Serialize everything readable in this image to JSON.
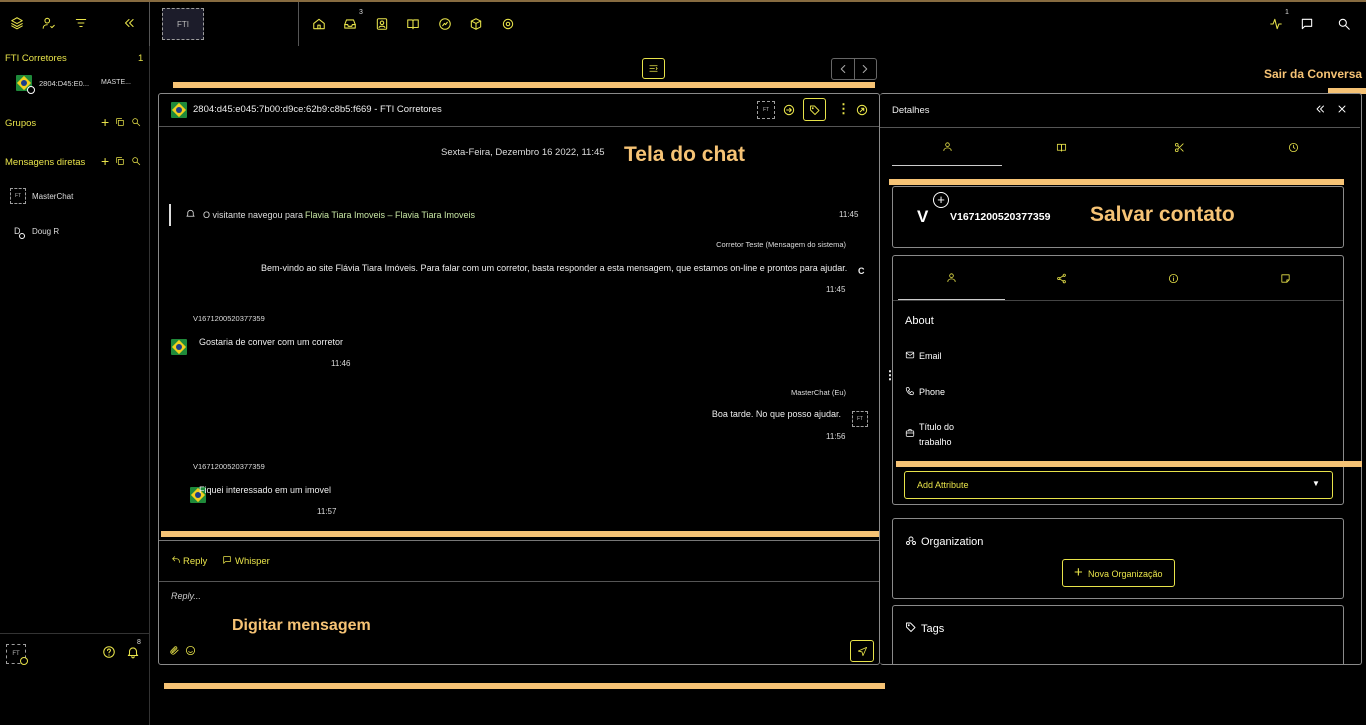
{
  "topbar": {
    "badge_inbox": "3",
    "badge_activity": "1"
  },
  "sidebar": {
    "section_main": "FTI Corretores",
    "section_main_count": "1",
    "conversation": {
      "id": "2804:D45:E0...",
      "owner": "MASTE..."
    },
    "section_groups": "Grupos",
    "section_direct": "Mensagens diretas",
    "direct_items": [
      {
        "name": "MasterChat"
      },
      {
        "name": "Doug R"
      }
    ],
    "bell_badge": "8"
  },
  "annotations": {
    "exit": "Sair da Conversa",
    "chat_screen": "Tela do chat",
    "save_contact": "Salvar contato",
    "type_message": "Digitar mensagem"
  },
  "chat": {
    "title": "2804:d45:e045:7b00:d9ce:62b9:c8b5:f669 - FTI Corretores",
    "date_header": "Sexta-Feira, Dezembro 16 2022, 11:45",
    "navigation": {
      "prefix": "O visitante navegou para",
      "link": "Flavia Tiara Imoveis – Flavia Tiara Imoveis",
      "time": "11:45"
    },
    "messages": [
      {
        "sender": "Corretor Teste (Mensagem do sistema)",
        "text": "Bem-vindo ao site Flávia Tiara Imóveis. Para falar com um corretor, basta responder a esta mensagem, que estamos on-line e prontos para ajudar.",
        "time": "11:45",
        "side": "right",
        "avatar": "C"
      },
      {
        "sender": "V1671200520377359",
        "text": "Gostaria de conver com um corretor",
        "time": "11:46",
        "side": "left"
      },
      {
        "sender": "MasterChat (Eu)",
        "text": "Boa tarde. No que posso ajudar.",
        "time": "11:56",
        "side": "right"
      },
      {
        "sender": "V1671200520377359",
        "text": "Fiquei interessado em um imovel",
        "time": "11:57",
        "side": "left"
      }
    ],
    "reply_tab": "Reply",
    "whisper_tab": "Whisper",
    "composer_placeholder": "Reply..."
  },
  "details": {
    "title": "Detalhes",
    "contact_initial": "V",
    "contact_name": "V1671200520377359",
    "about_title": "About",
    "fields": [
      {
        "label": "Email"
      },
      {
        "label": "Phone"
      },
      {
        "label": "Título do trabalho"
      }
    ],
    "add_attribute": "Add Attribute",
    "organization_title": "Organization",
    "new_org_button": "Nova Organização",
    "tags_title": "Tags"
  }
}
